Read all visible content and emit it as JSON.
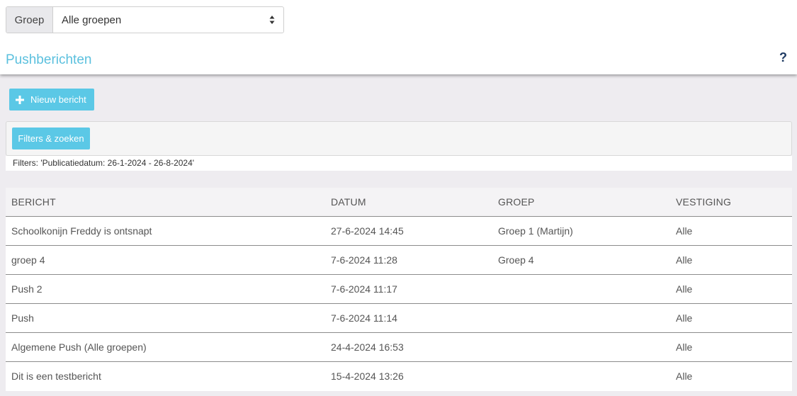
{
  "group_filter": {
    "label": "Groep",
    "selected": "Alle groepen"
  },
  "page": {
    "title": "Pushberichten",
    "help": "?"
  },
  "actions": {
    "new_message_label": "Nieuw bericht",
    "filters_label": "Filters & zoeken"
  },
  "filters": {
    "active_text": "Filters: 'Publicatiedatum: 26-1-2024 - 26-8-2024'"
  },
  "table": {
    "headers": [
      "BERICHT",
      "DATUM",
      "GROEP",
      "VESTIGING"
    ],
    "rows": [
      {
        "bericht": "Schoolkonijn Freddy is ontsnapt",
        "datum": "27-6-2024 14:45",
        "groep": "Groep 1 (Martijn)",
        "vestiging": "Alle"
      },
      {
        "bericht": "groep 4",
        "datum": "7-6-2024 11:28",
        "groep": "Groep 4",
        "vestiging": "Alle"
      },
      {
        "bericht": "Push 2",
        "datum": "7-6-2024 11:17",
        "groep": "",
        "vestiging": "Alle"
      },
      {
        "bericht": "Push",
        "datum": "7-6-2024 11:14",
        "groep": "",
        "vestiging": "Alle"
      },
      {
        "bericht": "Algemene Push (Alle groepen)",
        "datum": "24-4-2024 16:53",
        "groep": "",
        "vestiging": "Alle"
      },
      {
        "bericht": "Dit is een testbericht",
        "datum": "15-4-2024 13:26",
        "groep": "",
        "vestiging": "Alle"
      }
    ]
  },
  "colors": {
    "accent": "#5bc0de",
    "button": "#5bc8e6",
    "help_icon": "#1f3b63",
    "background": "#eeecf0"
  },
  "icons": {
    "select_arrows": "sort-arrows-icon",
    "plus": "plus-icon",
    "help": "question-icon"
  }
}
